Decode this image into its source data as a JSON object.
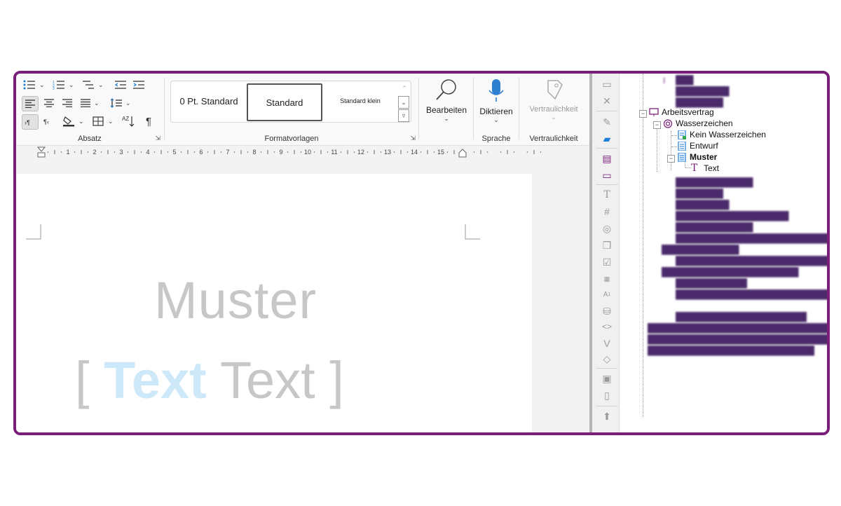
{
  "ribbon": {
    "groups": {
      "absatz": "Absatz",
      "formatvorlagen": "Formatvorlagen",
      "sprache": "Sprache",
      "vertraulichkeit": "Vertraulichkeit"
    },
    "styles": [
      "0 Pt. Standard",
      "Standard",
      "Standard klein"
    ],
    "buttons": {
      "bearbeiten": "Bearbeiten",
      "diktieren": "Diktieren",
      "vertraulichkeit": "Vertraulichkeit"
    },
    "sort_label": "AZ"
  },
  "ruler": {
    "ticks": [
      "1",
      "2",
      "3",
      "4",
      "5",
      "6",
      "7",
      "8",
      "9",
      "10",
      "11",
      "12",
      "13",
      "14",
      "15"
    ]
  },
  "document": {
    "watermark_line1": "Muster",
    "bracket_open": "[ ",
    "highlight_word": "Text",
    "rest": " Text ]"
  },
  "tree": {
    "visible_nodes": {
      "arbeitsvertrag": "Arbeitsvertrag",
      "wasserzeichen": "Wasserzeichen",
      "kein_wasserzeichen": "Kein Wasserzeichen",
      "entwurf": "Entwurf",
      "muster": "Muster",
      "text": "Text"
    },
    "blurred_count": 20
  },
  "colors": {
    "frame": "#7b1e7a",
    "watermark": "#c7c7c7",
    "highlight": "#cde8f8",
    "accent_icon": "#7b1e7a",
    "blue_icon": "#1e7fd6"
  }
}
